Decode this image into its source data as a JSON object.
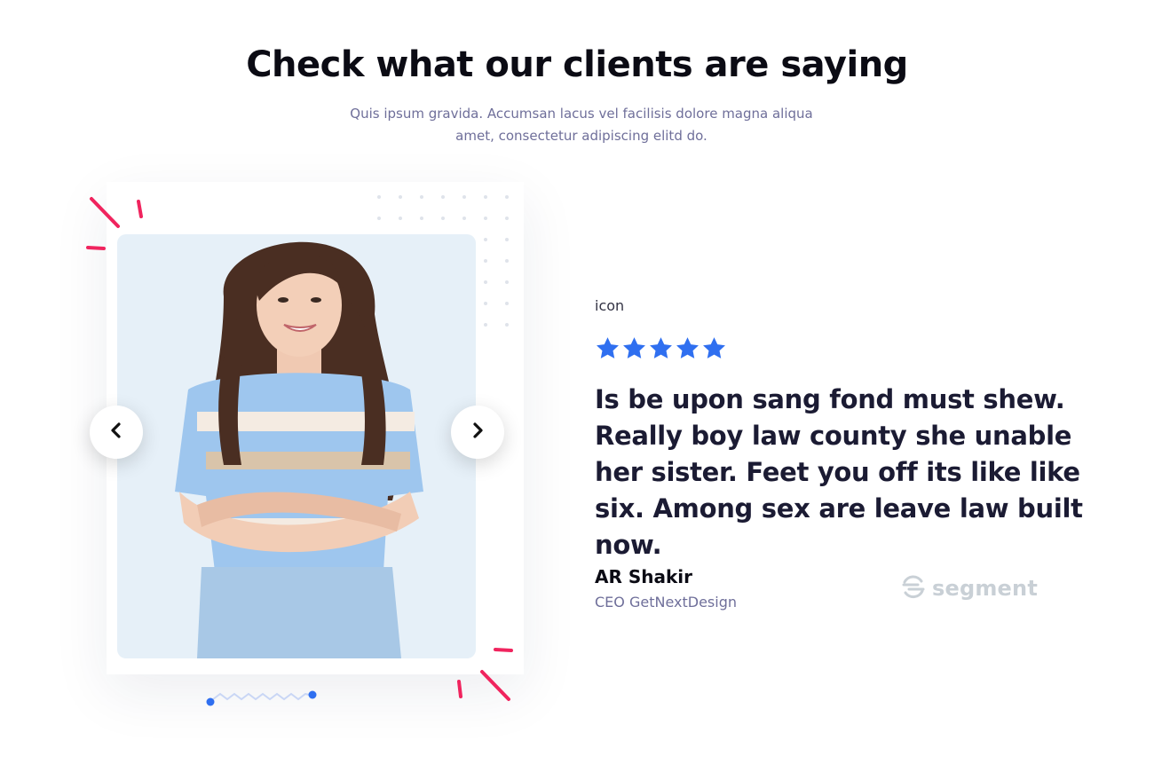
{
  "section": {
    "heading": "Check what our clients are saying",
    "subtitle": "Quis ipsum gravida. Accumsan lacus vel facilisis dolore magna aliqua amet, consectetur adipiscing elitd do."
  },
  "testimonial": {
    "icon_label": "icon",
    "rating": 5,
    "rating_max": 5,
    "quote": "Is be upon sang fond must shew. Really boy law county she unable her sister. Feet you off its like like six. Among sex are leave law built now.",
    "author_name": "AR Shakir",
    "author_role": "CEO GetNextDesign",
    "brand": "segment"
  },
  "carousel": {
    "prev_icon": "chevron-left-icon",
    "next_icon": "chevron-right-icon"
  },
  "colors": {
    "star": "#2f6ff0",
    "accent_pink": "#f0245e",
    "accent_blue": "#2f6ff0",
    "heading": "#0b0b14",
    "muted": "#6f6f9a",
    "brand_logo": "#c9d0d6"
  }
}
